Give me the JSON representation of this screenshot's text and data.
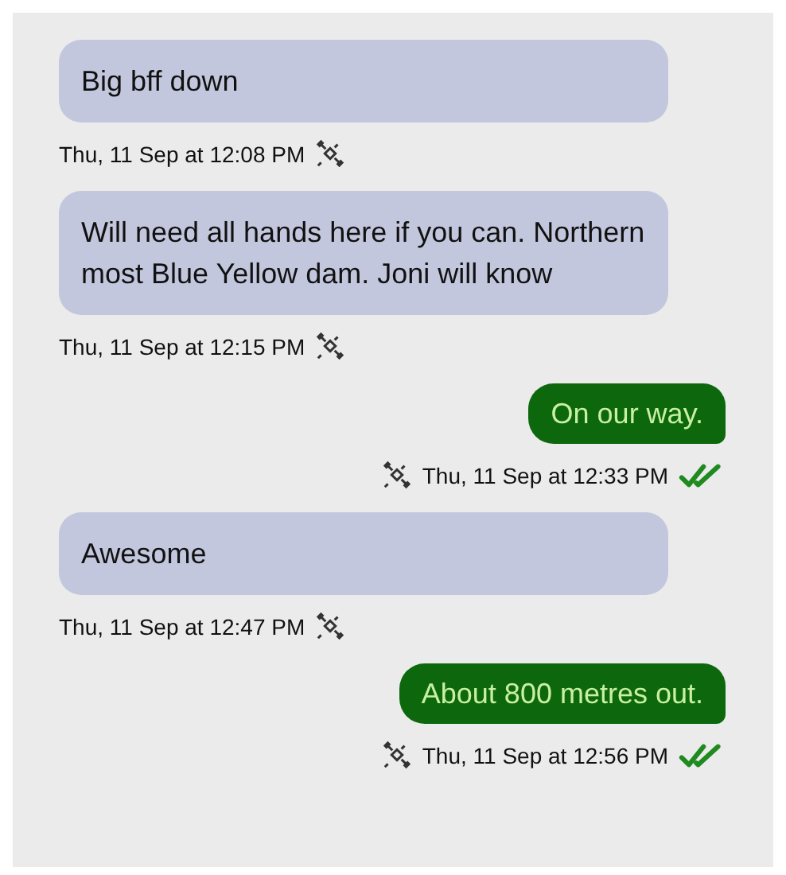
{
  "messages": [
    {
      "kind": "incoming",
      "text": "Big bff down",
      "time": "Thu, 11 Sep at 12:08 PM"
    },
    {
      "kind": "incoming",
      "text": "Will need all hands here if you can. Northern most Blue Yellow dam. Joni will know",
      "time": "Thu, 11 Sep at 12:15 PM"
    },
    {
      "kind": "outgoing",
      "text": "On our way.",
      "time": "Thu, 11 Sep at 12:33 PM",
      "delivered": true
    },
    {
      "kind": "incoming",
      "text": "Awesome",
      "time": "Thu, 11 Sep at 12:47 PM"
    },
    {
      "kind": "outgoing",
      "text": "About 800 metres out.",
      "time": "Thu, 11 Sep at 12:56 PM",
      "delivered": true
    }
  ]
}
